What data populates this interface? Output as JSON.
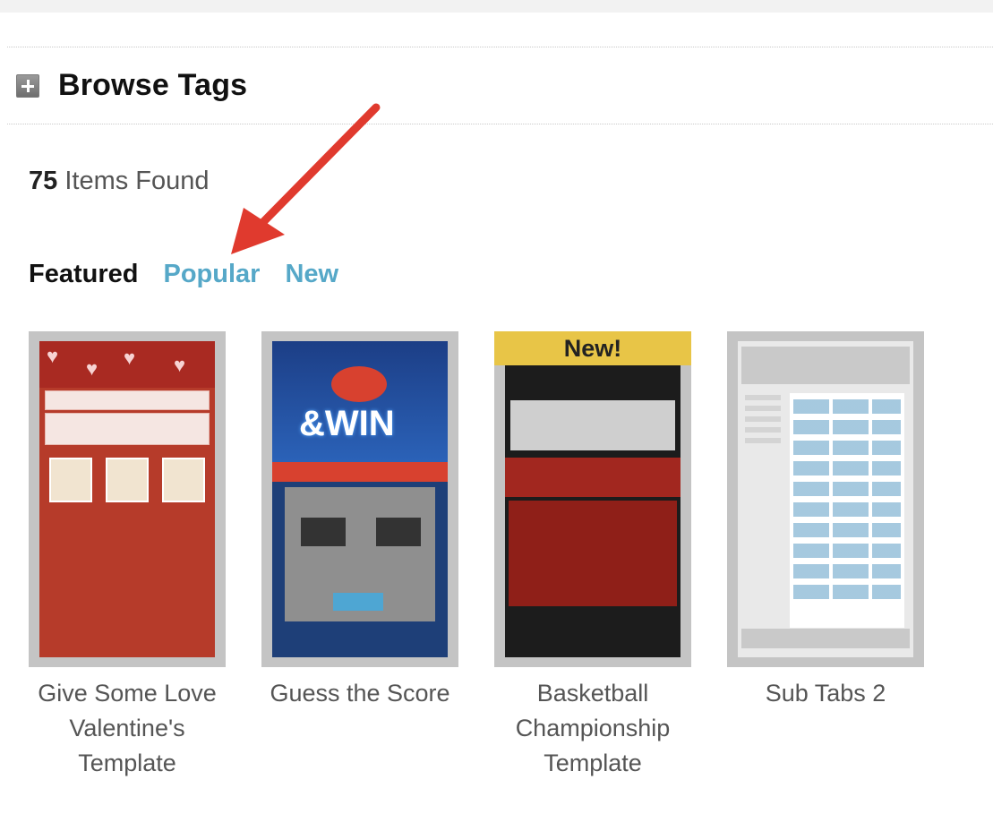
{
  "header": {
    "title": "Browse Tags"
  },
  "results": {
    "count": "75",
    "label": "Items Found"
  },
  "tabs": [
    {
      "label": "Featured",
      "active": true
    },
    {
      "label": "Popular",
      "active": false
    },
    {
      "label": "New",
      "active": false
    }
  ],
  "cards": [
    {
      "title": "Give Some Love Valentine's Template"
    },
    {
      "title": "Guess the Score"
    },
    {
      "title": "Basketball Championship Template",
      "badge": "New!"
    },
    {
      "title": "Sub Tabs 2"
    }
  ],
  "colors": {
    "link": "#56a8c8",
    "arrow": "#e03a2e",
    "frame": "#c4c4c4"
  }
}
